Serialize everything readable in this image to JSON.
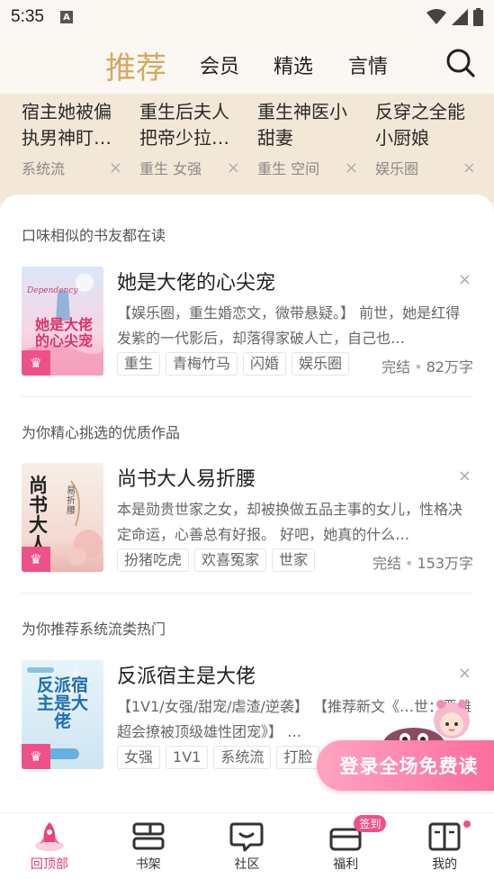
{
  "status_bar": {
    "time": "5:35",
    "a_icon": "A"
  },
  "nav": {
    "tabs": [
      {
        "label": "推荐",
        "active": true
      },
      {
        "label": "会员",
        "active": false
      },
      {
        "label": "精选",
        "active": false
      },
      {
        "label": "言情",
        "active": false
      }
    ],
    "search_icon": "search-icon"
  },
  "strip": [
    {
      "title": "宿主她被偏执男神盯…",
      "tag": "系统流"
    },
    {
      "title": "重生后夫人把帝少拉…",
      "tag": "重生 女强"
    },
    {
      "title": "重生神医小甜妻",
      "tag": "重生 空间"
    },
    {
      "title": "反穿之全能小厨娘",
      "tag": "娱乐圈"
    }
  ],
  "sections": [
    {
      "heading": "口味相似的书友都在读",
      "book": {
        "title": "她是大佬的心尖宠",
        "desc": "【娱乐圈，重生婚恋文，微带悬疑。】 前世，她是红得发紫的一代影后，却落得家破人亡，自己也…",
        "tags": [
          "重生",
          "青梅竹马",
          "闪婚",
          "娱乐圈"
        ],
        "status": "完结",
        "words": "82万字",
        "cover_text": "她是大佬的心尖宠",
        "cover_sub": "Dependency"
      }
    },
    {
      "heading": "为你精心挑选的优质作品",
      "book": {
        "title": "尚书大人易折腰",
        "desc": "本是勋贵世家之女，却被换做五品主事的女儿，性格决定命运，心善总有好报。 好吧，她真的什么…",
        "tags": [
          "扮猪吃虎",
          "欢喜冤家",
          "世家"
        ],
        "status": "完结",
        "words": "153万字",
        "cover_text": "尚书大人",
        "cover_sub": "易折腰"
      }
    },
    {
      "heading": "为你推荐系统流类热门",
      "book": {
        "title": "反派宿主是大佬",
        "desc": "【1V1/女强/甜宠/虐渣/逆袭】 【推荐新文《…世：恶雌超会撩被顶级雄性团宠》】 …",
        "tags": [
          "女强",
          "1V1",
          "系统流",
          "打脸"
        ],
        "status": "",
        "words": "",
        "cover_text": "反派宿主是大佬",
        "cover_sub": ""
      }
    }
  ],
  "close_glyph": "×",
  "crown_glyph": "♛",
  "login_banner": "登录全场免费读",
  "bottom_nav": [
    {
      "label": "回顶部",
      "icon": "rocket-icon",
      "active": true
    },
    {
      "label": "书架",
      "icon": "bookshelf-icon",
      "active": false
    },
    {
      "label": "社区",
      "icon": "chat-bubble-icon",
      "active": false
    },
    {
      "label": "福利",
      "icon": "gift-icon",
      "active": false,
      "badge": "签到"
    },
    {
      "label": "我的",
      "icon": "profile-book-icon",
      "active": false,
      "dot": true
    }
  ],
  "colors": {
    "accent": "#d7a860",
    "pink": "#f0508a",
    "strip_bg": "#f3e7d7"
  }
}
